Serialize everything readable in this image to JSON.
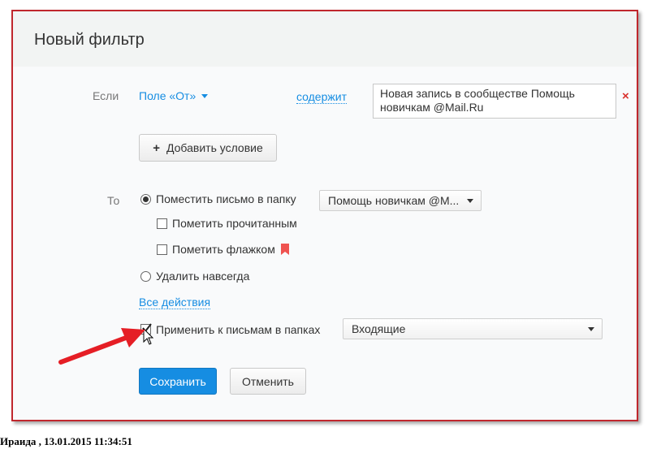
{
  "dialog": {
    "title": "Новый фильтр"
  },
  "condition": {
    "if_label": "Если",
    "field_select": "Поле «От»",
    "operator_link": "содержит",
    "value": "Новая запись в сообществе Помощь новичкам @Mail.Ru",
    "remove_symbol": "×"
  },
  "add_condition_button": {
    "plus": "+",
    "label": "Добавить условие"
  },
  "actions": {
    "to_label": "То",
    "move_to_folder": {
      "label": "Поместить письмо в папку",
      "checked": true
    },
    "folder_select": "Помощь новичкам @M...",
    "mark_read": {
      "label": "Пометить прочитанным",
      "checked": false
    },
    "mark_flag": {
      "label": "Пометить флажком",
      "checked": false
    },
    "delete_forever": {
      "label": "Удалить навсегда",
      "checked": false
    },
    "all_actions_link": "Все действия"
  },
  "apply": {
    "label": "Применить к письмам в папках",
    "checked": true,
    "folder_select": "Входящие"
  },
  "buttons": {
    "save": "Сохранить",
    "cancel": "Отменить"
  },
  "caption": "Ираида , 13.01.2015 11:34:51",
  "colors": {
    "frame_border": "#c0272d",
    "link": "#168de2",
    "save_button": "#168de2",
    "flag": "#ef5350",
    "arrow": "#e51e25",
    "remove_x": "#d9302c"
  }
}
